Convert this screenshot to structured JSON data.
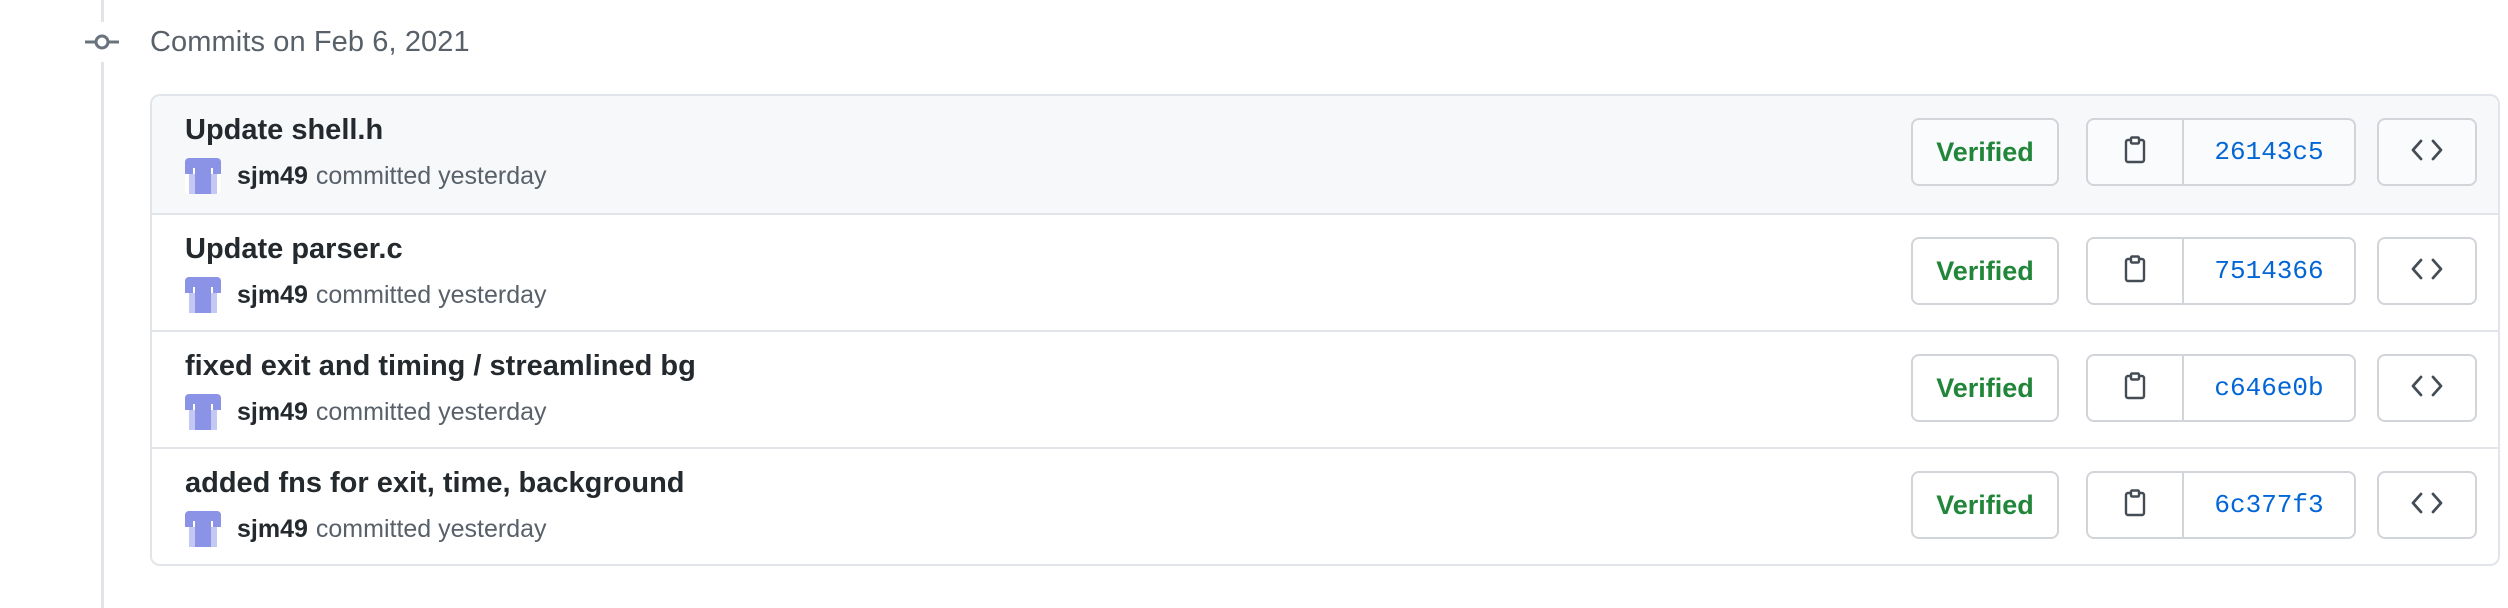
{
  "group": {
    "title": "Commits on Feb 6, 2021",
    "icon": "git-commit-icon"
  },
  "commits": [
    {
      "title": "Update shell.h",
      "author": "sjm49",
      "meta": "committed yesterday",
      "badge": "Verified",
      "sha": "26143c5"
    },
    {
      "title": "Update parser.c",
      "author": "sjm49",
      "meta": "committed yesterday",
      "badge": "Verified",
      "sha": "7514366"
    },
    {
      "title": "fixed exit and timing / streamlined bg",
      "author": "sjm49",
      "meta": "committed yesterday",
      "badge": "Verified",
      "sha": "c646e0b"
    },
    {
      "title": "added fns for exit, time, background",
      "author": "sjm49",
      "meta": "committed yesterday",
      "badge": "Verified",
      "sha": "6c377f3"
    }
  ],
  "icons": {
    "copy": "clipboard-icon",
    "browse": "code-icon",
    "avatar": "identicon-avatar"
  },
  "colors": {
    "verified": "#22863a",
    "sha_link": "#0366d6",
    "avatar": "#8b93e6",
    "border": "#e1e4e8"
  }
}
